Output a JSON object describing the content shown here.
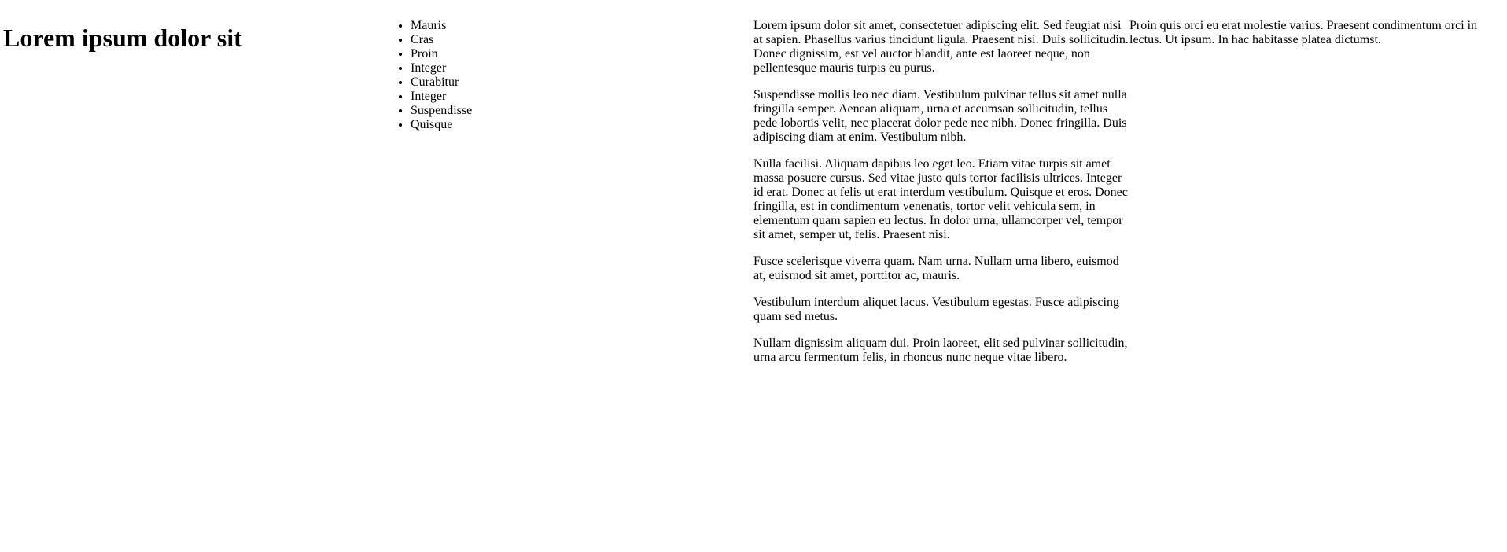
{
  "header": {
    "title": "Lorem ipsum dolor sit"
  },
  "nav": {
    "items": [
      "Mauris",
      "Cras",
      "Proin",
      "Integer",
      "Curabitur",
      "Integer",
      "Suspendisse",
      "Quisque"
    ]
  },
  "main": {
    "paragraphs": [
      "Lorem ipsum dolor sit amet, consectetuer adipiscing elit. Sed feugiat nisi at sapien. Phasellus varius tincidunt ligula. Praesent nisi. Duis sollicitudin. Donec dignissim, est vel auctor blandit, ante est laoreet neque, non pellentesque mauris turpis eu purus.",
      "Suspendisse mollis leo nec diam. Vestibulum pulvinar tellus sit amet nulla fringilla semper. Aenean aliquam, urna et accumsan sollicitudin, tellus pede lobortis velit, nec placerat dolor pede nec nibh. Donec fringilla. Duis adipiscing diam at enim. Vestibulum nibh.",
      "Nulla facilisi. Aliquam dapibus leo eget leo. Etiam vitae turpis sit amet massa posuere cursus. Sed vitae justo quis tortor facilisis ultrices. Integer id erat. Donec at felis ut erat interdum vestibulum. Quisque et eros. Donec fringilla, est in condimentum venenatis, tortor velit vehicula sem, in elementum quam sapien eu lectus. In dolor urna, ullamcorper vel, tempor sit amet, semper ut, felis. Praesent nisi.",
      "Fusce scelerisque viverra quam. Nam urna. Nullam urna libero, euismod at, euismod sit amet, porttitor ac, mauris.",
      "Vestibulum interdum aliquet lacus. Vestibulum egestas. Fusce adipiscing quam sed metus.",
      "Nullam dignissim aliquam dui. Proin laoreet, elit sed pulvinar sollicitudin, urna arcu fermentum felis, in rhoncus nunc neque vitae libero."
    ]
  },
  "aside": {
    "text": "Proin quis orci eu erat molestie varius. Praesent condimentum orci in lectus. Ut ipsum. In hac habitasse platea dictumst."
  }
}
